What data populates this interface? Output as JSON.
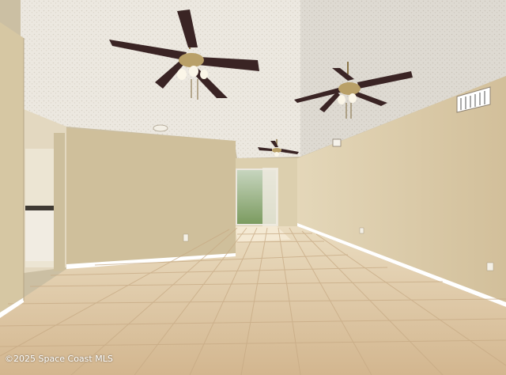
{
  "photo": {
    "subject": "Empty living room with vaulted ceiling, tiled floor and three ceiling fans",
    "colors": {
      "ceiling": "#eeebe4",
      "wall_right": "#d9c9a6",
      "wall_partition": "#cbbb98",
      "floor": "#dcc19d",
      "baseboard": "#ffffff",
      "fan_blade": "#3a2424",
      "fan_fixture": "#b9a068"
    },
    "objects": [
      "ceiling-fan",
      "ceiling-fan",
      "ceiling-fan",
      "air-vent",
      "air-vent",
      "smoke-detector",
      "sliding-glass-door",
      "electrical-outlet"
    ]
  },
  "watermark": {
    "text": "©2025 Space Coast MLS"
  }
}
